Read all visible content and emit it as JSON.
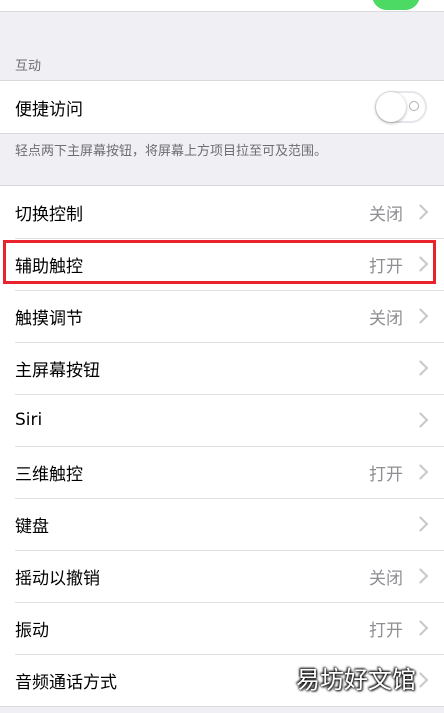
{
  "section": {
    "header": "互动"
  },
  "reachability": {
    "label": "便捷访问",
    "enabled": false,
    "footer": "轻点两下主屏幕按钮，将屏幕上方项目拉至可及范围。"
  },
  "rows": [
    {
      "label": "切换控制",
      "value": "关闭"
    },
    {
      "label": "辅助触控",
      "value": "打开"
    },
    {
      "label": "触摸调节",
      "value": "关闭"
    },
    {
      "label": "主屏幕按钮",
      "value": ""
    },
    {
      "label": "Siri",
      "value": ""
    },
    {
      "label": "三维触控",
      "value": "打开"
    },
    {
      "label": "键盘",
      "value": ""
    },
    {
      "label": "摇动以撤销",
      "value": "关闭"
    },
    {
      "label": "振动",
      "value": "打开"
    },
    {
      "label": "音频通话方式",
      "value": ""
    }
  ],
  "watermark": "易坊好文馆",
  "colors": {
    "highlight": "#e8232d",
    "toggle_on": "#4cd964"
  }
}
